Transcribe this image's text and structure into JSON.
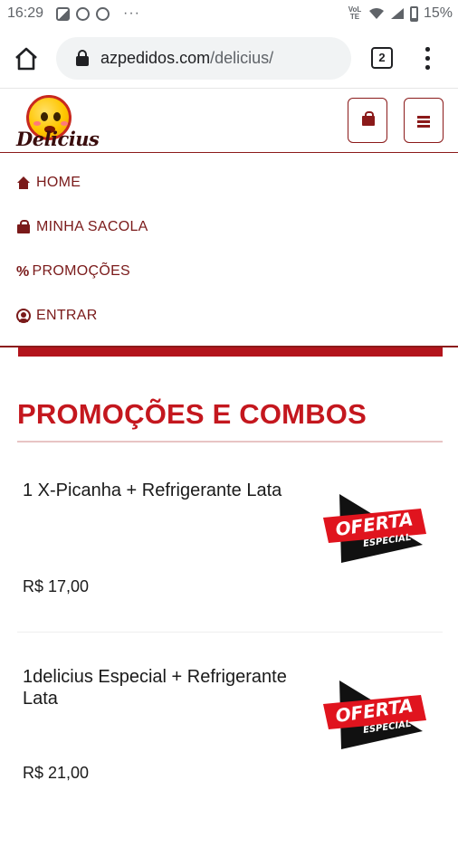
{
  "status_bar": {
    "time": "16:29",
    "more": "···",
    "network": "VoLTE",
    "battery": "15%"
  },
  "browser": {
    "url_host": "azpedidos.com",
    "url_path": "/delicius/",
    "tab_count": "2"
  },
  "site": {
    "logo_text": "Delicius",
    "brand_color": "#8b1a1a",
    "accent_color": "#c4171e"
  },
  "nav": {
    "items": [
      {
        "label": "HOME",
        "icon": "home-icon"
      },
      {
        "label": "MINHA SACOLA",
        "icon": "shopping-bag-icon"
      },
      {
        "label": "PROMOÇÕES",
        "icon": "percent-icon"
      },
      {
        "label": "ENTRAR",
        "icon": "user-circle-icon"
      }
    ]
  },
  "main": {
    "section_title": "PROMOÇÕES E COMBOS",
    "products": [
      {
        "name": "1 X-Picanha + Refrigerante Lata",
        "price": "R$ 17,00",
        "badge_line1": "OFERTA",
        "badge_line2": "ESPECIAL"
      },
      {
        "name": "1delicius Especial + Refrigerante Lata",
        "price": "R$ 21,00",
        "badge_line1": "OFERTA",
        "badge_line2": "ESPECIAL"
      }
    ]
  }
}
